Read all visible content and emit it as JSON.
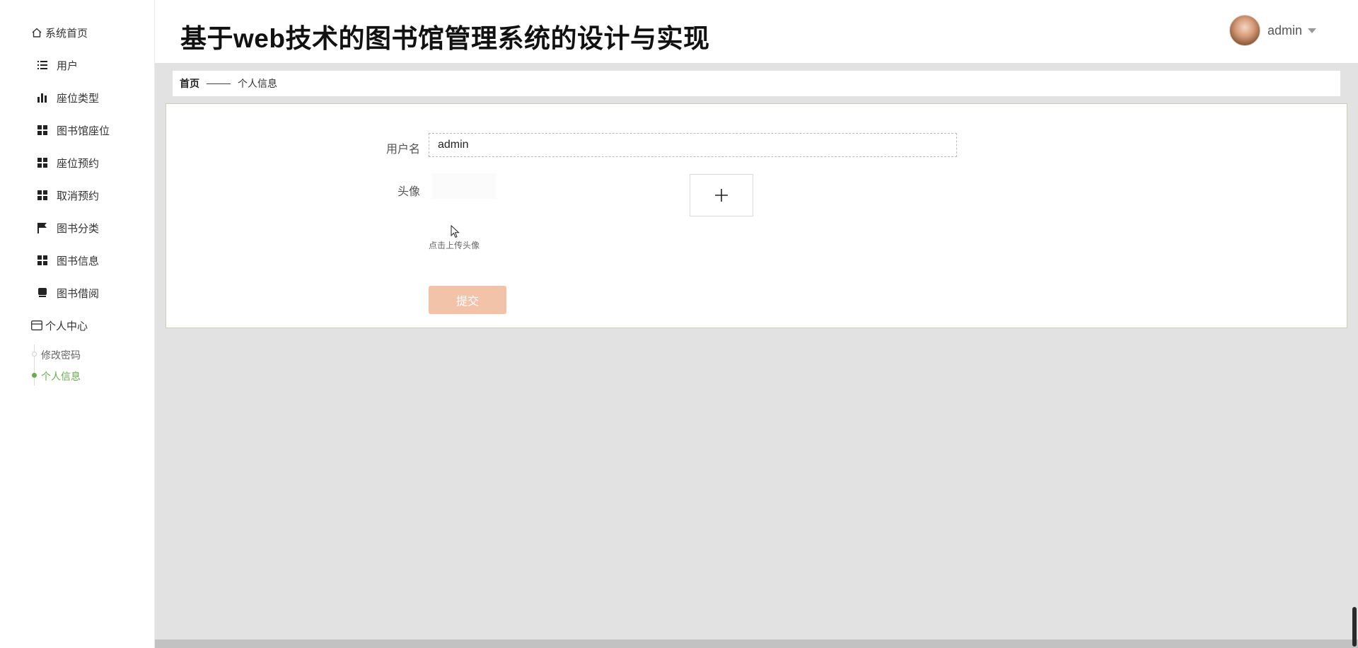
{
  "app": {
    "title": "基于web技术的图书馆管理系统的设计与实现"
  },
  "user": {
    "name": "admin"
  },
  "sidebar": {
    "home": {
      "label": "系统首页",
      "icon": "home-icon"
    },
    "items": [
      {
        "label": "用户",
        "icon": "list-icon"
      },
      {
        "label": "座位类型",
        "icon": "bar-chart-icon"
      },
      {
        "label": "图书馆座位",
        "icon": "grid-icon"
      },
      {
        "label": "座位预约",
        "icon": "grid-icon"
      },
      {
        "label": "取消预约",
        "icon": "grid-icon"
      },
      {
        "label": "图书分类",
        "icon": "flag-icon"
      },
      {
        "label": "图书信息",
        "icon": "grid-icon"
      },
      {
        "label": "图书借阅",
        "icon": "book-icon"
      }
    ],
    "personal_center": {
      "label": "个人中心",
      "icon": "card-icon",
      "children": [
        {
          "label": "修改密码",
          "active": false
        },
        {
          "label": "个人信息",
          "active": true
        }
      ]
    },
    "active_color": "#67ad4c"
  },
  "breadcrumb": {
    "home": "首页",
    "current": "个人信息"
  },
  "form": {
    "username_label": "用户名",
    "username_value": "admin",
    "avatar_label": "头像",
    "upload_hint": "点击上传头像",
    "submit_label": "提交",
    "submit_color": "#f3c3a9"
  }
}
